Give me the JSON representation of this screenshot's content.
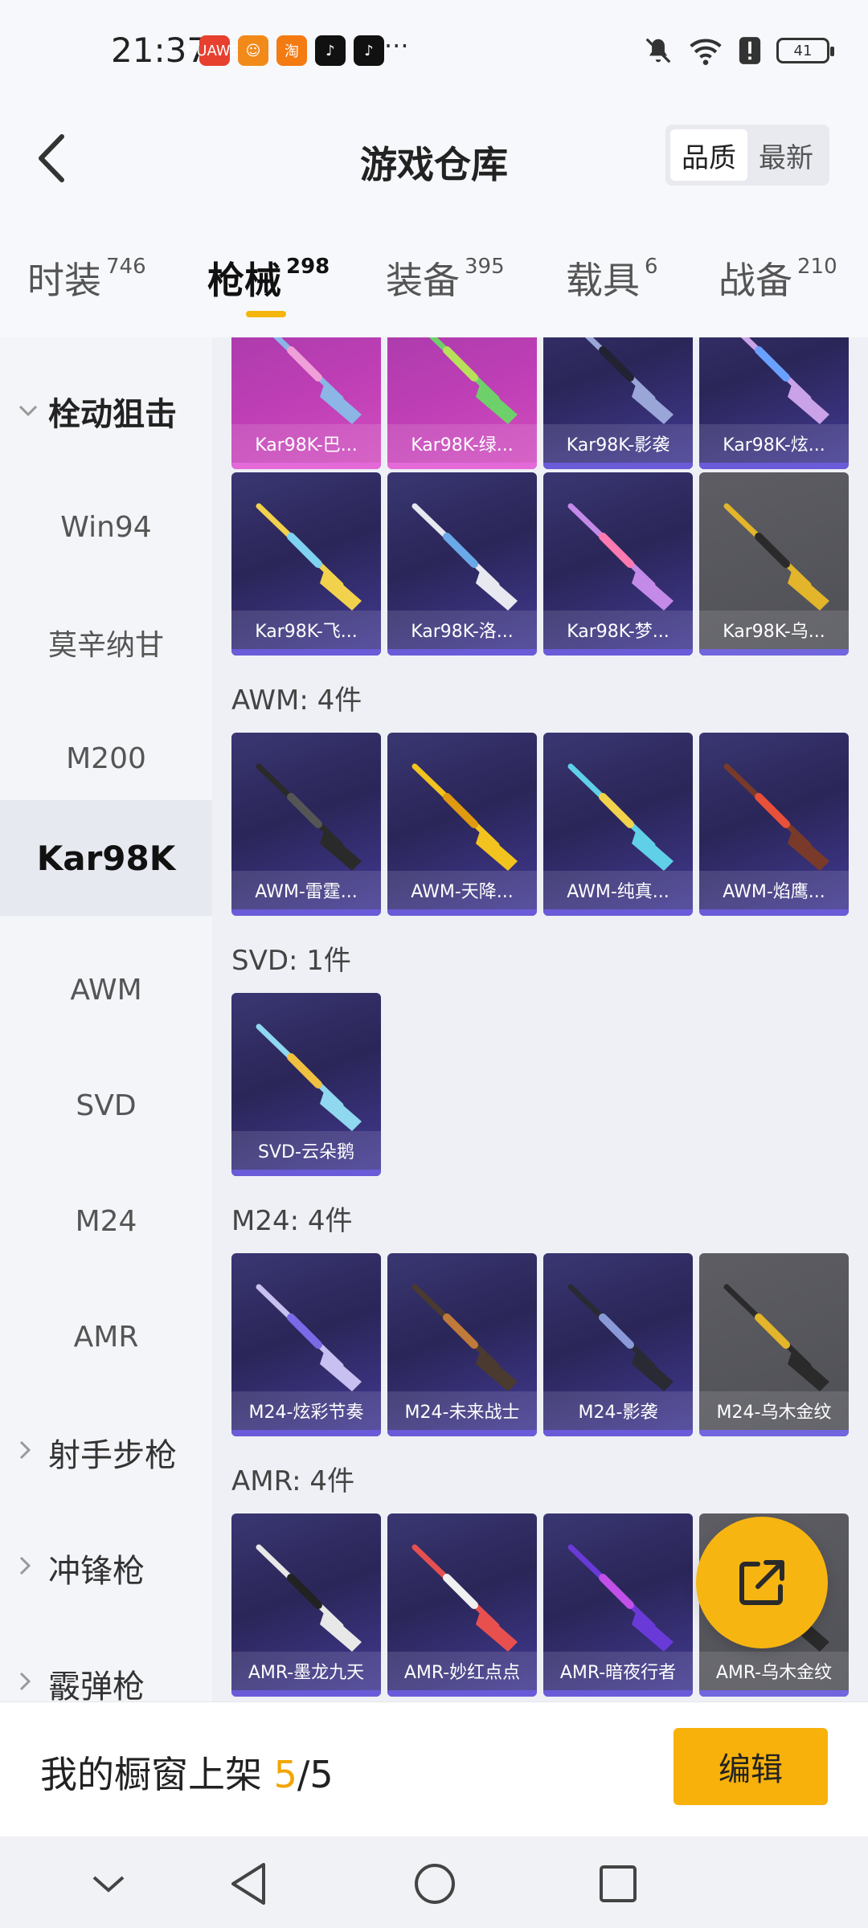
{
  "status_bar": {
    "time": "21:37",
    "app_icons": [
      {
        "name": "huawei-app-icon",
        "label": "HUAWEI",
        "color": "#e8402f"
      },
      {
        "name": "emoji-app-icon",
        "label": "☺",
        "color": "#f28a1a"
      },
      {
        "name": "taobao-app-icon",
        "label": "淘",
        "color": "#f47a12"
      },
      {
        "name": "tiktok-app-icon",
        "label": "♪",
        "color": "#111111"
      },
      {
        "name": "tiktok-app-icon-2",
        "label": "♪",
        "color": "#111111"
      }
    ],
    "more": "···",
    "battery": "41"
  },
  "header": {
    "title": "游戏仓库",
    "sort_options": [
      "品质",
      "最新"
    ],
    "sort_selected": "品质"
  },
  "tabs": [
    {
      "label": "时装",
      "count": "746"
    },
    {
      "label": "枪械",
      "count": "298",
      "active": true
    },
    {
      "label": "装备",
      "count": "395"
    },
    {
      "label": "载具",
      "count": "6"
    },
    {
      "label": "战备",
      "count": "210"
    }
  ],
  "sidebar": {
    "group_open": "栓动狙击",
    "items": [
      "Win94",
      "莫辛纳甘",
      "M200",
      "Kar98K",
      "AWM",
      "SVD",
      "M24",
      "AMR"
    ],
    "active": "Kar98K",
    "groups_closed": [
      "射手步枪",
      "冲锋枪",
      "霰弹枪"
    ]
  },
  "kar98k_cards": [
    {
      "caption": "Kar98K-巴...",
      "style": "pink",
      "gun": "#8bb6e6",
      "accent": "#f0a0d8"
    },
    {
      "caption": "Kar98K-绿...",
      "style": "pink",
      "gun": "#6ed06a",
      "accent": "#b8e05a"
    },
    {
      "caption": "Kar98K-影袭",
      "style": "purple",
      "gun": "#9aa6d8",
      "accent": "#222233"
    },
    {
      "caption": "Kar98K-炫...",
      "style": "purple",
      "gun": "#c9a2e8",
      "accent": "#6aa0ff"
    },
    {
      "caption": "Kar98K-飞...",
      "style": "purple",
      "gun": "#f2d24c",
      "accent": "#7fd2f0"
    },
    {
      "caption": "Kar98K-洛...",
      "style": "purple",
      "gun": "#e8e8f0",
      "accent": "#6aa8e8"
    },
    {
      "caption": "Kar98K-梦...",
      "style": "purple",
      "gun": "#c48ae8",
      "accent": "#ff7ab0"
    },
    {
      "caption": "Kar98K-乌...",
      "style": "gray",
      "gun": "#e2b52a",
      "accent": "#2a2a2a"
    }
  ],
  "sections": [
    {
      "title": "AWM: 4件",
      "cards": [
        {
          "caption": "AWM-雷霆...",
          "style": "purple",
          "gun": "#2a2a2a",
          "accent": "#555555"
        },
        {
          "caption": "AWM-天降...",
          "style": "purple",
          "gun": "#f2c31e",
          "accent": "#e09a10"
        },
        {
          "caption": "AWM-纯真...",
          "style": "purple",
          "gun": "#5fd0e8",
          "accent": "#f2d24c"
        },
        {
          "caption": "AWM-焰鹰...",
          "style": "purple",
          "gun": "#7a3a2a",
          "accent": "#e8503a"
        }
      ]
    },
    {
      "title": "SVD: 1件",
      "cards": [
        {
          "caption": "SVD-云朵鹅",
          "style": "purple",
          "gun": "#8fd8f0",
          "accent": "#f0c040"
        }
      ]
    },
    {
      "title": "M24: 4件",
      "cards": [
        {
          "caption": "M24-炫彩节奏",
          "style": "purple",
          "gun": "#c8c0f0",
          "accent": "#7a6ae8"
        },
        {
          "caption": "M24-未来战士",
          "style": "purple",
          "gun": "#4a3a30",
          "accent": "#c07a3a"
        },
        {
          "caption": "M24-影袭",
          "style": "purple",
          "gun": "#2a2a35",
          "accent": "#8a9ad8"
        },
        {
          "caption": "M24-乌木金纹",
          "style": "gray",
          "gun": "#2a2a2a",
          "accent": "#e2b52a"
        }
      ]
    },
    {
      "title": "AMR: 4件",
      "cards": [
        {
          "caption": "AMR-墨龙九天",
          "style": "purple",
          "gun": "#e8e8e8",
          "accent": "#222222"
        },
        {
          "caption": "AMR-妙红点点",
          "style": "purple",
          "gun": "#e85050",
          "accent": "#f0f0f0"
        },
        {
          "caption": "AMR-暗夜行者",
          "style": "purple",
          "gun": "#6a3ad8",
          "accent": "#c050e8"
        },
        {
          "caption": "AMR-乌木金纹",
          "style": "gray",
          "gun": "#2a2a2a",
          "accent": "#e2b52a"
        }
      ]
    }
  ],
  "showcase": {
    "prefix": "我的橱窗上架",
    "count": "5",
    "total": "/5",
    "edit_label": "编辑"
  },
  "colors": {
    "accent_yellow": "#f7b10a",
    "tab_underline": "#f5b50a"
  }
}
